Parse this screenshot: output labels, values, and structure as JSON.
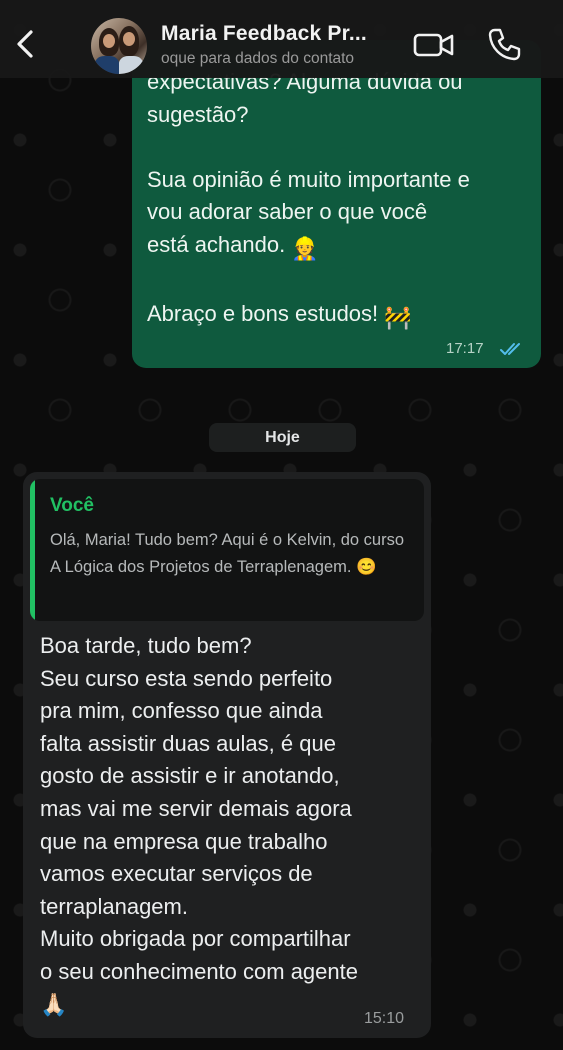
{
  "header": {
    "title": "Maria Feedback Pr...",
    "subtitle": "oque para dados do contato"
  },
  "icons": {
    "back": "chevron-left-icon",
    "video": "video-call-icon",
    "call": "phone-icon"
  },
  "outgoing": {
    "lines": [
      "expectativas? Alguma dúvida ou",
      "sugestão?",
      "",
      "Sua opinião é muito importante e",
      "vou adorar saber o que você",
      "está achando.",
      "",
      "Abraço e bons estudos!"
    ],
    "emoji_1": "👷",
    "emoji_2": "🚧",
    "time": "17:17",
    "status": "read"
  },
  "date_divider": "Hoje",
  "incoming": {
    "quote_author": "Você",
    "quote_text": "Olá, Maria! Tudo bem? Aqui é o Kelvin, do curso A Lógica dos Projetos de Terraplenagem. 😊",
    "lines": [
      "Boa tarde, tudo bem?",
      "Seu curso esta sendo perfeito",
      "pra mim, confesso que ainda",
      "falta assistir duas aulas, é que",
      "gosto de assistir e ir anotando,",
      "mas vai me servir demais agora",
      "que na empresa que trabalho",
      "vamos executar serviços de",
      "terraplanagem.",
      "Muito obrigada por compartilhar",
      "o seu conhecimento com agente",
      "🙏🏻"
    ],
    "time": "15:10"
  },
  "colors": {
    "outgoing_bubble": "#0f5a3e",
    "incoming_bubble": "#1f2021",
    "quote_accent": "#21c063",
    "read_ticks": "#53bdeb"
  }
}
